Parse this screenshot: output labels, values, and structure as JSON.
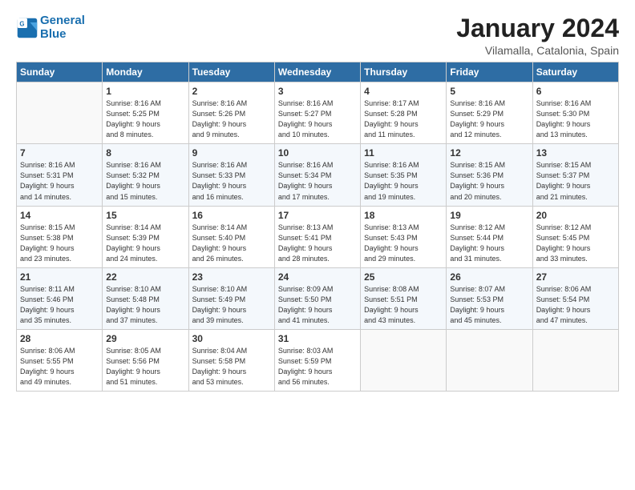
{
  "header": {
    "logo_line1": "General",
    "logo_line2": "Blue",
    "title": "January 2024",
    "subtitle": "Vilamalla, Catalonia, Spain"
  },
  "weekdays": [
    "Sunday",
    "Monday",
    "Tuesday",
    "Wednesday",
    "Thursday",
    "Friday",
    "Saturday"
  ],
  "weeks": [
    [
      {
        "day": "",
        "detail": ""
      },
      {
        "day": "1",
        "detail": "Sunrise: 8:16 AM\nSunset: 5:25 PM\nDaylight: 9 hours\nand 8 minutes."
      },
      {
        "day": "2",
        "detail": "Sunrise: 8:16 AM\nSunset: 5:26 PM\nDaylight: 9 hours\nand 9 minutes."
      },
      {
        "day": "3",
        "detail": "Sunrise: 8:16 AM\nSunset: 5:27 PM\nDaylight: 9 hours\nand 10 minutes."
      },
      {
        "day": "4",
        "detail": "Sunrise: 8:17 AM\nSunset: 5:28 PM\nDaylight: 9 hours\nand 11 minutes."
      },
      {
        "day": "5",
        "detail": "Sunrise: 8:16 AM\nSunset: 5:29 PM\nDaylight: 9 hours\nand 12 minutes."
      },
      {
        "day": "6",
        "detail": "Sunrise: 8:16 AM\nSunset: 5:30 PM\nDaylight: 9 hours\nand 13 minutes."
      }
    ],
    [
      {
        "day": "7",
        "detail": "Sunrise: 8:16 AM\nSunset: 5:31 PM\nDaylight: 9 hours\nand 14 minutes."
      },
      {
        "day": "8",
        "detail": "Sunrise: 8:16 AM\nSunset: 5:32 PM\nDaylight: 9 hours\nand 15 minutes."
      },
      {
        "day": "9",
        "detail": "Sunrise: 8:16 AM\nSunset: 5:33 PM\nDaylight: 9 hours\nand 16 minutes."
      },
      {
        "day": "10",
        "detail": "Sunrise: 8:16 AM\nSunset: 5:34 PM\nDaylight: 9 hours\nand 17 minutes."
      },
      {
        "day": "11",
        "detail": "Sunrise: 8:16 AM\nSunset: 5:35 PM\nDaylight: 9 hours\nand 19 minutes."
      },
      {
        "day": "12",
        "detail": "Sunrise: 8:15 AM\nSunset: 5:36 PM\nDaylight: 9 hours\nand 20 minutes."
      },
      {
        "day": "13",
        "detail": "Sunrise: 8:15 AM\nSunset: 5:37 PM\nDaylight: 9 hours\nand 21 minutes."
      }
    ],
    [
      {
        "day": "14",
        "detail": "Sunrise: 8:15 AM\nSunset: 5:38 PM\nDaylight: 9 hours\nand 23 minutes."
      },
      {
        "day": "15",
        "detail": "Sunrise: 8:14 AM\nSunset: 5:39 PM\nDaylight: 9 hours\nand 24 minutes."
      },
      {
        "day": "16",
        "detail": "Sunrise: 8:14 AM\nSunset: 5:40 PM\nDaylight: 9 hours\nand 26 minutes."
      },
      {
        "day": "17",
        "detail": "Sunrise: 8:13 AM\nSunset: 5:41 PM\nDaylight: 9 hours\nand 28 minutes."
      },
      {
        "day": "18",
        "detail": "Sunrise: 8:13 AM\nSunset: 5:43 PM\nDaylight: 9 hours\nand 29 minutes."
      },
      {
        "day": "19",
        "detail": "Sunrise: 8:12 AM\nSunset: 5:44 PM\nDaylight: 9 hours\nand 31 minutes."
      },
      {
        "day": "20",
        "detail": "Sunrise: 8:12 AM\nSunset: 5:45 PM\nDaylight: 9 hours\nand 33 minutes."
      }
    ],
    [
      {
        "day": "21",
        "detail": "Sunrise: 8:11 AM\nSunset: 5:46 PM\nDaylight: 9 hours\nand 35 minutes."
      },
      {
        "day": "22",
        "detail": "Sunrise: 8:10 AM\nSunset: 5:48 PM\nDaylight: 9 hours\nand 37 minutes."
      },
      {
        "day": "23",
        "detail": "Sunrise: 8:10 AM\nSunset: 5:49 PM\nDaylight: 9 hours\nand 39 minutes."
      },
      {
        "day": "24",
        "detail": "Sunrise: 8:09 AM\nSunset: 5:50 PM\nDaylight: 9 hours\nand 41 minutes."
      },
      {
        "day": "25",
        "detail": "Sunrise: 8:08 AM\nSunset: 5:51 PM\nDaylight: 9 hours\nand 43 minutes."
      },
      {
        "day": "26",
        "detail": "Sunrise: 8:07 AM\nSunset: 5:53 PM\nDaylight: 9 hours\nand 45 minutes."
      },
      {
        "day": "27",
        "detail": "Sunrise: 8:06 AM\nSunset: 5:54 PM\nDaylight: 9 hours\nand 47 minutes."
      }
    ],
    [
      {
        "day": "28",
        "detail": "Sunrise: 8:06 AM\nSunset: 5:55 PM\nDaylight: 9 hours\nand 49 minutes."
      },
      {
        "day": "29",
        "detail": "Sunrise: 8:05 AM\nSunset: 5:56 PM\nDaylight: 9 hours\nand 51 minutes."
      },
      {
        "day": "30",
        "detail": "Sunrise: 8:04 AM\nSunset: 5:58 PM\nDaylight: 9 hours\nand 53 minutes."
      },
      {
        "day": "31",
        "detail": "Sunrise: 8:03 AM\nSunset: 5:59 PM\nDaylight: 9 hours\nand 56 minutes."
      },
      {
        "day": "",
        "detail": ""
      },
      {
        "day": "",
        "detail": ""
      },
      {
        "day": "",
        "detail": ""
      }
    ]
  ]
}
